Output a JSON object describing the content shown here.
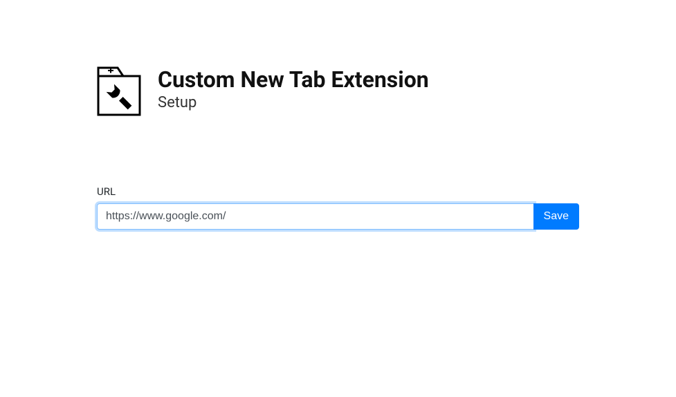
{
  "header": {
    "title": "Custom New Tab Extension",
    "subtitle": "Setup"
  },
  "form": {
    "url_label": "URL",
    "url_value": "https://www.google.com/",
    "url_placeholder": "",
    "save_label": "Save"
  },
  "icons": {
    "logo": "settings-tab-icon"
  },
  "colors": {
    "primary": "#007bff",
    "focus_ring": "rgba(0,123,255,.25)"
  }
}
